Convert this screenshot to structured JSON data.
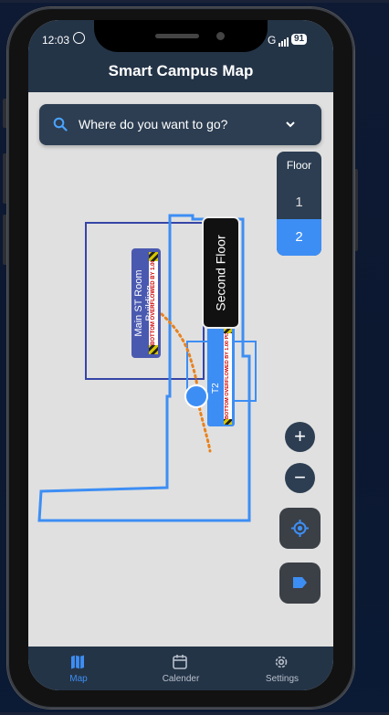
{
  "status_bar": {
    "time": "12:03",
    "network": "G",
    "battery": "91"
  },
  "header": {
    "title": "Smart Campus Map"
  },
  "search": {
    "placeholder": "Where do you want to go?"
  },
  "floor_selector": {
    "label": "Floor",
    "floors": [
      "1",
      "2"
    ],
    "selected": "2"
  },
  "map": {
    "buildings": [
      {
        "label": "Main ST Room Building",
        "overflow_text": "BOTTOM OVERFLOWED BY 1.00 PIXELS"
      },
      {
        "label": "T2",
        "overflow_text": "BOTTOM OVERFLOWED BY 1.00 PIX"
      }
    ],
    "tooltip": "Second Floor"
  },
  "controls": {
    "zoom_in": "+",
    "zoom_out": "−"
  },
  "nav": {
    "items": [
      {
        "label": "Map"
      },
      {
        "label": "Calender"
      },
      {
        "label": "Settings"
      }
    ]
  },
  "colors": {
    "primary": "#243447",
    "accent": "#3d8ef4",
    "map_bg": "#e0e0e0",
    "route": "#e8821e",
    "outline_blue": "#3d8ef4",
    "outline_navy": "#3545a6"
  }
}
